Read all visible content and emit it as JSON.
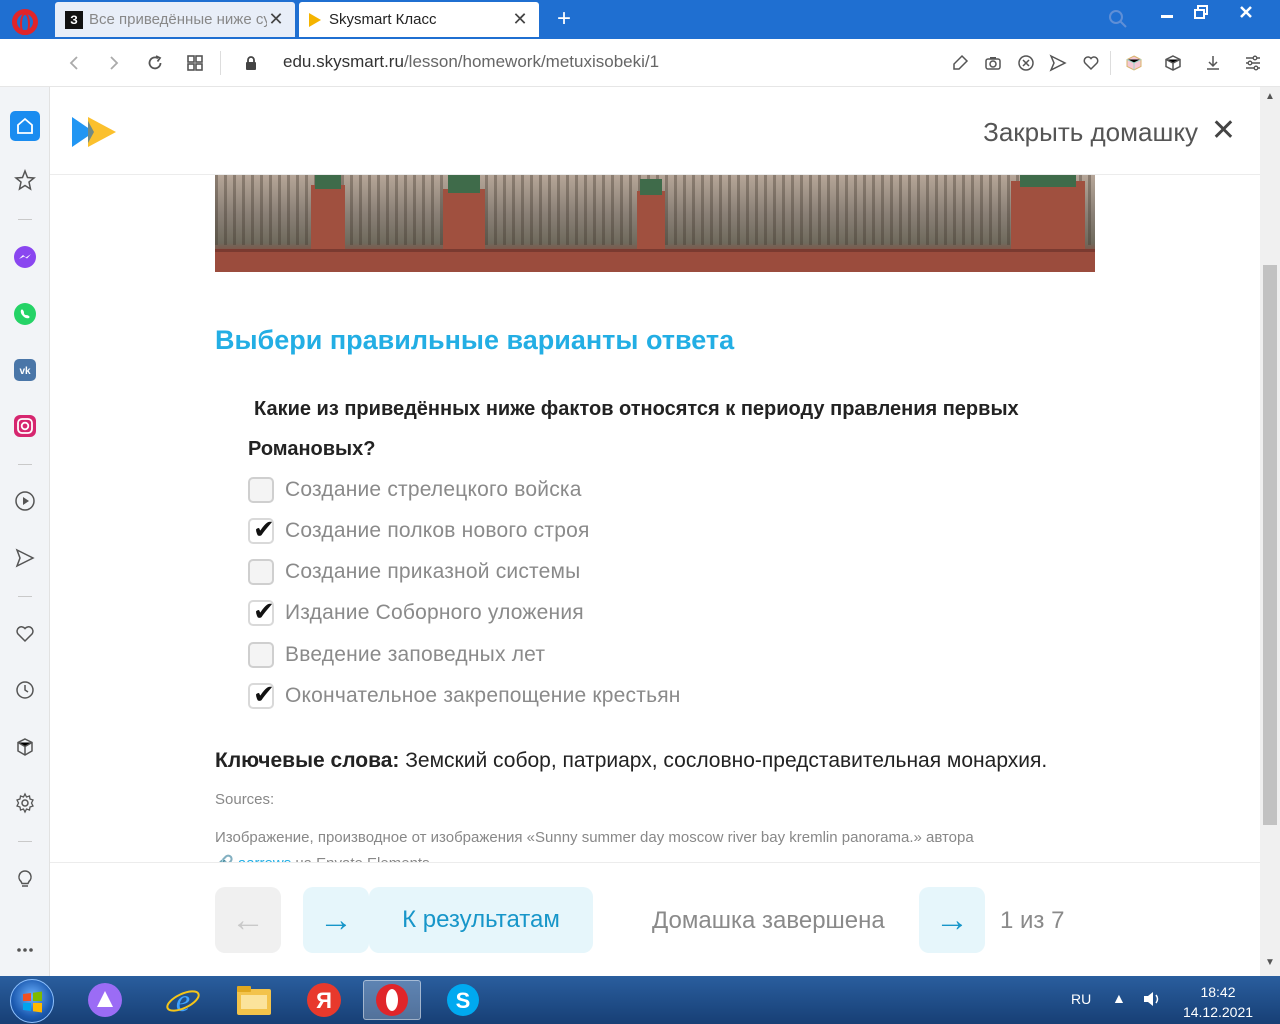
{
  "browser": {
    "tabs": [
      {
        "favicon": "З",
        "title": "Все приведённые ниже су"
      },
      {
        "title": "Skysmart Класс"
      }
    ],
    "new_tab": "+",
    "url_host": "edu.skysmart.ru",
    "url_path": "/lesson/homework/metuxisobeki/1"
  },
  "header": {
    "close_homework": "Закрыть домашку",
    "close_symbol": "✕"
  },
  "task": {
    "title": "Выбери правильные варианты ответа",
    "question": "Какие из приведённых ниже фактов относятся к периоду правления первых Романовых?",
    "options": [
      {
        "label": "Создание стрелецкого войска",
        "checked": false
      },
      {
        "label": "Создание полков нового строя",
        "checked": true
      },
      {
        "label": "Создание приказной системы",
        "checked": false
      },
      {
        "label": "Издание Соборного уложения",
        "checked": true
      },
      {
        "label": "Введение заповедных лет",
        "checked": false
      },
      {
        "label": "Окончательное закрепощение крестьян",
        "checked": true
      }
    ],
    "keywords_label": "Ключевые слова:",
    "keywords_text": " Земский собор, патриарх, сословно-представительная монархия.",
    "sources_label": "Sources:",
    "sources_text_1": "Изображение, производное от изображения «Sunny summer day moscow river bay kremlin panorama.» автора ",
    "sources_link": "aarrows",
    "sources_text_2": " на Envato Elements"
  },
  "footer": {
    "prev_arrow": "←",
    "next_arrow": "→",
    "results": "К результатам",
    "done": "Домашка завершена",
    "pager": "1 из 7"
  },
  "taskbar": {
    "lang": "RU",
    "time": "18:42",
    "date": "14.12.2021"
  }
}
